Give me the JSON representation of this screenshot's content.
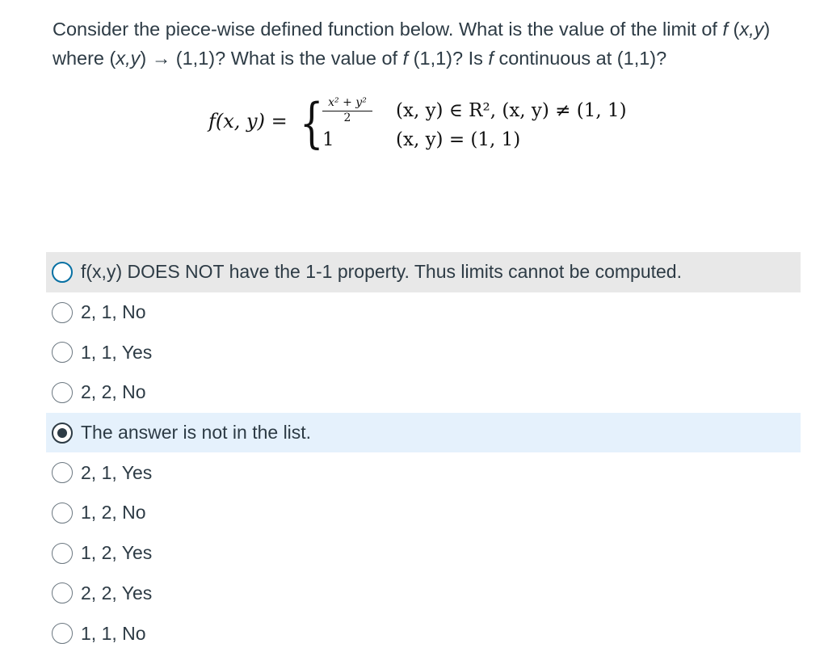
{
  "question": {
    "p1": "Consider the piece-wise defined function below. What is the value of the limit of ",
    "f1": "f",
    "p2": " (",
    "xy1": "x,y",
    "p3": ") where (",
    "xy2": "x,y",
    "p4": ") → (1,1)? What is the value of ",
    "f2": "f",
    "p5": " (1,1)? Is ",
    "f3": "f",
    "p6": " continuous at (1,1)?"
  },
  "formula": {
    "lhs_f": "f",
    "lhs_args": "(x, y) =",
    "brace": "{",
    "frac_num": "x² + y²",
    "frac_den": "2",
    "case2_value": "1",
    "case1_condition": "(x, y) ∈ R², (x, y) ≠ (1, 1)",
    "case2_condition": "(x, y) = (1, 1)"
  },
  "options": [
    {
      "label": "f(x,y) DOES NOT have the 1-1 property. Thus limits cannot be computed.",
      "state": "hover"
    },
    {
      "label": "2, 1, No",
      "state": "none"
    },
    {
      "label": "1, 1, Yes",
      "state": "none"
    },
    {
      "label": "2, 2, No",
      "state": "none"
    },
    {
      "label": "The answer is not in the list.",
      "state": "selected"
    },
    {
      "label": "2, 1, Yes",
      "state": "none"
    },
    {
      "label": "1, 2, No",
      "state": "none"
    },
    {
      "label": "1, 2, Yes",
      "state": "none"
    },
    {
      "label": "2, 2, Yes",
      "state": "none"
    },
    {
      "label": "1, 1, No",
      "state": "none"
    }
  ],
  "colors": {
    "text": "#2d3b45",
    "hover_bg": "#e8e8e8",
    "selected_bg": "#e5f1fc"
  }
}
